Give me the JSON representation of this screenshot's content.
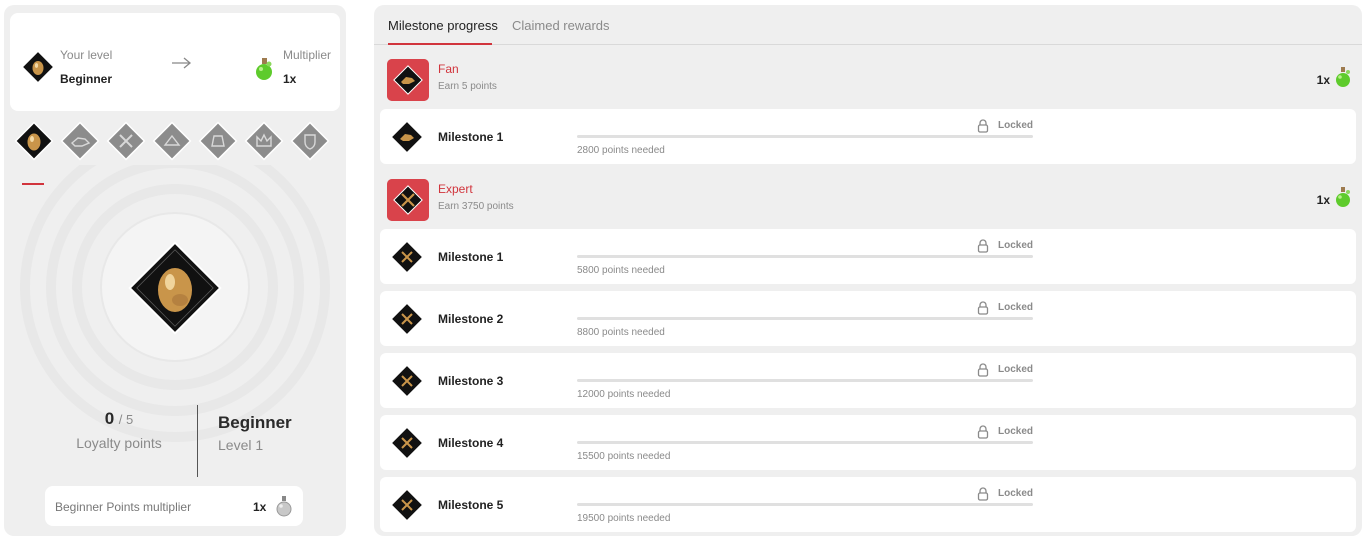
{
  "summary": {
    "your_level_label": "Your level",
    "your_level_value": "Beginner",
    "multiplier_label": "Multiplier",
    "multiplier_value": "1x"
  },
  "tier_icons": [
    "beginner-egg-icon",
    "fan-icon",
    "expert-icon",
    "tier-4-icon",
    "tier-5-icon",
    "tier-6-icon",
    "tier-7-icon"
  ],
  "stats": {
    "points_current": "0",
    "points_total": "/ 5",
    "points_label": "Loyalty points",
    "level_name": "Beginner",
    "level_number": "Level 1"
  },
  "points_multiplier": {
    "label": "Beginner Points multiplier",
    "value": "1x"
  },
  "tabs": {
    "milestone_progress": "Milestone progress",
    "claimed_rewards": "Claimed rewards"
  },
  "tiers": [
    {
      "name": "Fan",
      "requirement": "Earn 5 points",
      "multiplier": "1x",
      "milestones": [
        {
          "name": "Milestone 1",
          "status": "Locked",
          "needed": "2800 points needed",
          "progress": 0
        }
      ]
    },
    {
      "name": "Expert",
      "requirement": "Earn 3750 points",
      "multiplier": "1x",
      "milestones": [
        {
          "name": "Milestone 1",
          "status": "Locked",
          "needed": "5800 points needed",
          "progress": 0
        },
        {
          "name": "Milestone 2",
          "status": "Locked",
          "needed": "8800 points needed",
          "progress": 0
        },
        {
          "name": "Milestone 3",
          "status": "Locked",
          "needed": "12000 points needed",
          "progress": 0
        },
        {
          "name": "Milestone 4",
          "status": "Locked",
          "needed": "15500 points needed",
          "progress": 0
        },
        {
          "name": "Milestone 5",
          "status": "Locked",
          "needed": "19500 points needed",
          "progress": 0
        }
      ]
    }
  ],
  "colors": {
    "accent": "#d1343c",
    "panel_bg": "#efefef",
    "card_bg": "#ffffff",
    "muted_text": "#8a8a8a"
  }
}
